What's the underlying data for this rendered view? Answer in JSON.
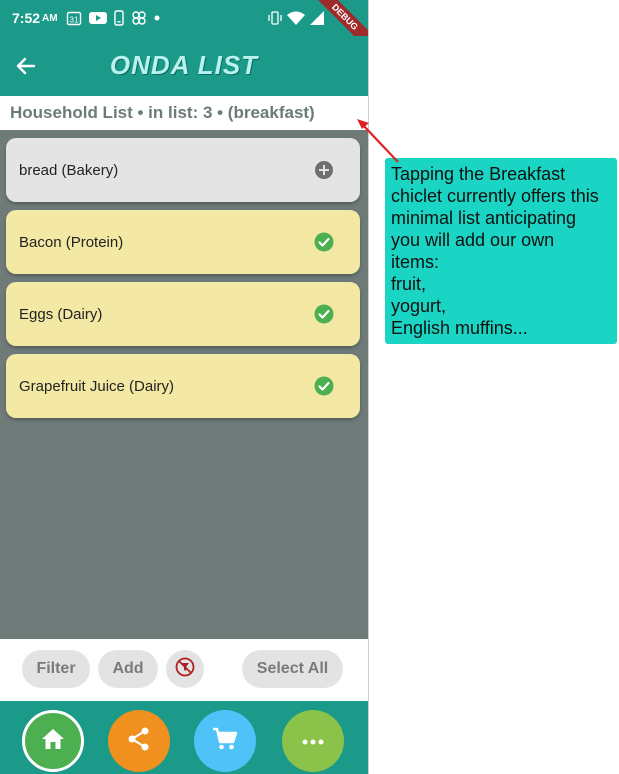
{
  "status_bar": {
    "time": "7:52",
    "ampm": "AM",
    "calendar_day": "31",
    "debug_banner": "DEBUG",
    "icons": [
      "calendar-icon",
      "youtube-icon",
      "phone-icon",
      "pinwheel-icon",
      "dot-icon",
      "vibrate-icon",
      "wifi-icon",
      "signal-icon"
    ]
  },
  "app_bar": {
    "title": "ONDA LIST",
    "back_icon": "arrow-left-icon"
  },
  "subtitle": "Household List  •  in list: 3  •  (breakfast)",
  "items": [
    {
      "label": "bread (Bakery)",
      "state": "add",
      "icon": "plus-circle-icon",
      "color": "#e4e4e4"
    },
    {
      "label": "Bacon (Protein)",
      "state": "checked",
      "icon": "check-circle-icon",
      "color": "#f3e9a4"
    },
    {
      "label": "Eggs (Dairy)",
      "state": "checked",
      "icon": "check-circle-icon",
      "color": "#f3e9a4"
    },
    {
      "label": "Grapefruit Juice (Dairy)",
      "state": "checked",
      "icon": "check-circle-icon",
      "color": "#f3e9a4"
    }
  ],
  "toolbar": {
    "filter_label": "Filter",
    "add_label": "Add",
    "no_filter_icon": "filter-off-icon",
    "select_all_label": "Select All"
  },
  "bottom_nav": [
    {
      "name": "home",
      "icon": "home-icon",
      "color": "#4caf50"
    },
    {
      "name": "share",
      "icon": "share-icon",
      "color": "#f0901e"
    },
    {
      "name": "cart",
      "icon": "cart-icon",
      "color": "#4fc3f7"
    },
    {
      "name": "more",
      "icon": "more-icon",
      "color": "#8bc34a"
    }
  ],
  "callout": {
    "lines": [
      "Tapping the Breakfast",
      "chiclet currently offers this",
      "minimal list anticipating",
      "you will add our own",
      "items:",
      "fruit,",
      "yogurt,",
      "English muffins..."
    ],
    "color": "#1ad4c4"
  },
  "colors": {
    "primary": "#1b9a8a",
    "background": "#6e7b78",
    "check": "#4caf50",
    "arrow": "#e02020"
  }
}
